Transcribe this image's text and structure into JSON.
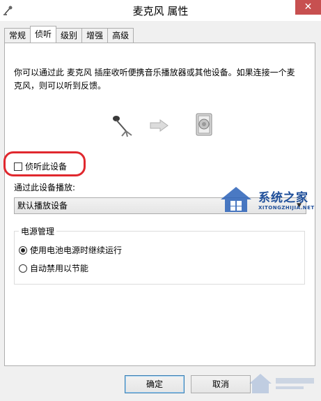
{
  "window": {
    "title": "麦克风 属性",
    "close_label": "✕"
  },
  "tabs": [
    {
      "label": "常规",
      "active": false
    },
    {
      "label": "侦听",
      "active": true
    },
    {
      "label": "级别",
      "active": false
    },
    {
      "label": "增强",
      "active": false
    },
    {
      "label": "高级",
      "active": false
    }
  ],
  "listen": {
    "description": "你可以通过此 麦克风 插座收听便携音乐播放器或其他设备。如果连接一个麦克风，则可以听到反馈。",
    "checkbox_label": "侦听此设备",
    "checkbox_checked": false,
    "play_label": "通过此设备播放:",
    "device_selected": "默认播放设备"
  },
  "power": {
    "group_label": "电源管理",
    "options": [
      {
        "label": "使用电池电源时继续运行",
        "checked": true
      },
      {
        "label": "自动禁用以节能",
        "checked": false
      }
    ]
  },
  "buttons": {
    "ok": "确定",
    "cancel": "取消"
  },
  "watermark": {
    "title": "系统之家",
    "url": "XITONGZHIJIA.NET"
  },
  "colors": {
    "highlight": "#e0282e",
    "watermark": "#1f4f9a",
    "close_button": "#c75050"
  }
}
